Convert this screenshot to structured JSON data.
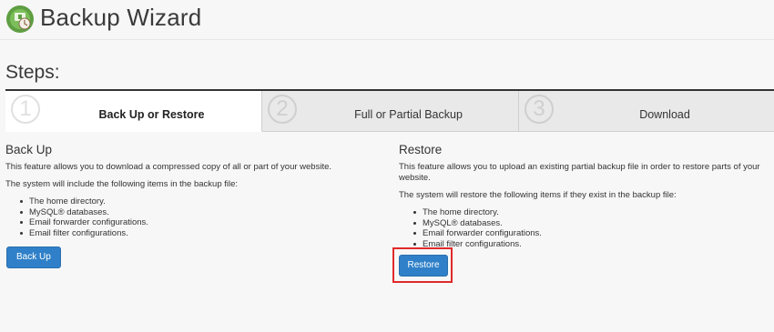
{
  "header": {
    "title": "Backup Wizard",
    "icon": "backup-wizard-icon"
  },
  "steps": {
    "heading": "Steps:",
    "items": [
      {
        "number": "1",
        "label": "Back Up or Restore",
        "active": true
      },
      {
        "number": "2",
        "label": "Full or Partial Backup",
        "active": false
      },
      {
        "number": "3",
        "label": "Download",
        "active": false
      }
    ]
  },
  "backup": {
    "title": "Back Up",
    "description": "This feature allows you to download a compressed copy of all or part of your website.",
    "includes_text": "The system will include the following items in the backup file:",
    "items": [
      "The home directory.",
      "MySQL® databases.",
      "Email forwarder configurations.",
      "Email filter configurations."
    ],
    "button_label": "Back Up"
  },
  "restore": {
    "title": "Restore",
    "description": "This feature allows you to upload an existing partial backup file in order to restore parts of your website.",
    "includes_text": "The system will restore the following items if they exist in the backup file:",
    "items": [
      "The home directory.",
      "MySQL® databases.",
      "Email forwarder configurations.",
      "Email filter configurations."
    ],
    "button_label": "Restore"
  },
  "colors": {
    "accent": "#2f80c8",
    "highlight": "#e02a2a",
    "icon_green": "#6aa84f"
  }
}
